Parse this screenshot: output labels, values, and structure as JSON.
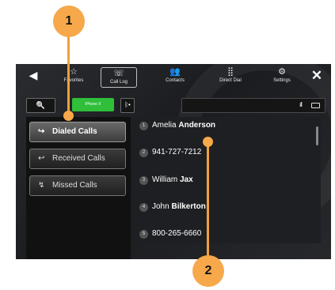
{
  "topbar": {
    "back_icon": "◀",
    "close_icon": "✕",
    "tabs": [
      {
        "label": "Favorites",
        "icon": "☆"
      },
      {
        "label": "Call Log",
        "icon": "☏"
      },
      {
        "label": "Contacts",
        "icon": "👥"
      },
      {
        "label": "Direct Dial",
        "icon": "⣿"
      },
      {
        "label": "Settings",
        "icon": "⚙"
      }
    ]
  },
  "toolbar": {
    "search_icon": "🔍",
    "phone_label": "iPhone X",
    "bluetooth_icon": "ᛒ•",
    "signal_icon": "ıll"
  },
  "left_menu": [
    {
      "label": "Dialed Calls",
      "icon": "↪"
    },
    {
      "label": "Received Calls",
      "icon": "↩"
    },
    {
      "label": "Missed Calls",
      "icon": "↯"
    }
  ],
  "calls": [
    {
      "num": "1",
      "first": "Amelia",
      "last": "Anderson"
    },
    {
      "num": "2",
      "first": "941-727-7212",
      "last": ""
    },
    {
      "num": "3",
      "first": "William",
      "last": "Jax"
    },
    {
      "num": "4",
      "first": "John",
      "last": "Bilkerton"
    },
    {
      "num": "5",
      "first": "800-265-6660",
      "last": ""
    }
  ],
  "callouts": [
    {
      "label": "1"
    },
    {
      "label": "2"
    }
  ],
  "colors": {
    "accent": "#f6a84a",
    "phone_green": "#2fbf3a"
  }
}
